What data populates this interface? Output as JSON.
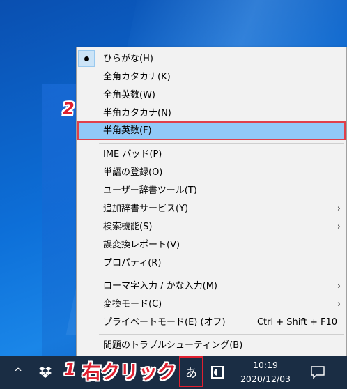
{
  "menu": {
    "items": [
      {
        "label": "ひらがな(H)",
        "checked": true
      },
      {
        "label": "全角カタカナ(K)"
      },
      {
        "label": "全角英数(W)"
      },
      {
        "label": "半角カタカナ(N)"
      },
      {
        "label": "半角英数(F)",
        "highlighted": true
      },
      {
        "label": "IME パッド(P)"
      },
      {
        "label": "単語の登録(O)"
      },
      {
        "label": "ユーザー辞書ツール(T)"
      },
      {
        "label": "追加辞書サービス(Y)",
        "submenu": true
      },
      {
        "label": "検索機能(S)",
        "submenu": true
      },
      {
        "label": "誤変換レポート(V)"
      },
      {
        "label": "プロパティ(R)"
      },
      {
        "label": "ローマ字入力 / かな入力(M)",
        "submenu": true
      },
      {
        "label": "変換モード(C)",
        "submenu": true
      },
      {
        "label": "プライベートモード(E) (オフ)",
        "shortcut": "Ctrl + Shift + F10"
      },
      {
        "label": "問題のトラブルシューティング(B)"
      }
    ],
    "arrow_glyph": "›"
  },
  "annotations": {
    "step1_number": "1",
    "step1_text": "右クリック",
    "step2_number": "2",
    "color": "#e02030"
  },
  "taskbar": {
    "chevron": "^",
    "ime_indicator": "あ",
    "clock_time": "10:19",
    "clock_date": "2020/12/03"
  }
}
